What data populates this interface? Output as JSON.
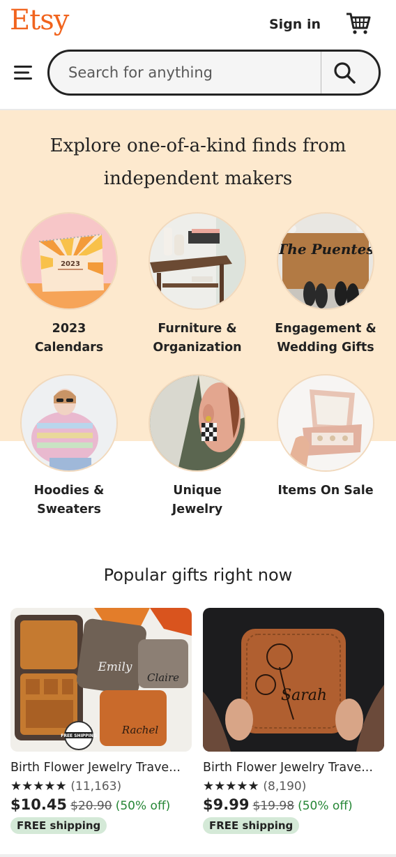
{
  "header": {
    "logo": "Etsy",
    "sign_in": "Sign in",
    "search_placeholder": "Search for anything"
  },
  "hero": {
    "title_line1": "Explore one-of-a-kind finds from",
    "title_line2": "independent makers",
    "categories": [
      {
        "line1": "2023",
        "line2": "Calendars"
      },
      {
        "line1": "Furniture &",
        "line2": "Organization"
      },
      {
        "line1": "Engagement &",
        "line2": "Wedding Gifts"
      },
      {
        "line1": "Hoodies &",
        "line2": "Sweaters"
      },
      {
        "line1": "Unique",
        "line2": "Jewelry"
      },
      {
        "line1": "Items On Sale",
        "line2": ""
      }
    ],
    "calendar_year": "2023",
    "doormat_text": "The Puentes"
  },
  "popular": {
    "title": "Popular gifts right now",
    "items": [
      {
        "title": "Birth Flower Jewelry Trave...",
        "stars": "★★★★★",
        "reviews": "(11,163)",
        "price": "$10.45",
        "old_price": "$20.90",
        "discount": "(50% off)",
        "shipping": "FREE shipping",
        "names": [
          "Emily",
          "Claire",
          "Rachel"
        ],
        "stamp": "FREE SHIPPING"
      },
      {
        "title": "Birth Flower Jewelry Trave...",
        "stars": "★★★★★",
        "reviews": "(8,190)",
        "price": "$9.99",
        "old_price": "$19.98",
        "discount": "(50% off)",
        "shipping": "FREE shipping",
        "names": [
          "Sarah"
        ]
      }
    ]
  },
  "colors": {
    "brand": "#f1641e",
    "hero_bg": "#fde9ce",
    "discount": "#258635",
    "badge_bg": "#d4e9d7"
  },
  "icons": [
    "cart-icon",
    "menu-icon",
    "search-icon",
    "star-icon"
  ]
}
